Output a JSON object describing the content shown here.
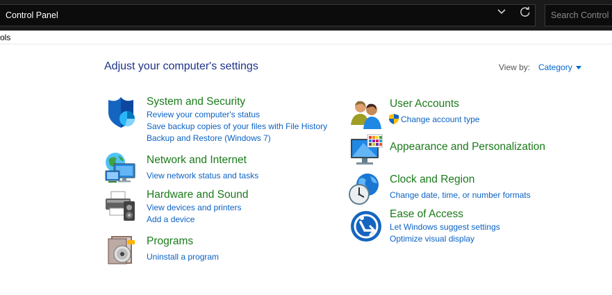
{
  "window": {
    "address_text": "Control Panel",
    "search_placeholder": "Search Control Panel",
    "menu_partial": "ols"
  },
  "main": {
    "heading": "Adjust your computer's settings",
    "view_by_label": "View by:",
    "view_by_value": "Category"
  },
  "categories_left": [
    {
      "icon": "shield-icon",
      "title": "System and Security",
      "links": [
        "Review your computer's status",
        "Save backup copies of your files with File History",
        "Backup and Restore (Windows 7)"
      ]
    },
    {
      "icon": "network-globe-icon",
      "title": "Network and Internet",
      "links": [
        "View network status and tasks"
      ]
    },
    {
      "icon": "printer-speaker-icon",
      "title": "Hardware and Sound",
      "links": [
        "View devices and printers",
        "Add a device"
      ]
    },
    {
      "icon": "programs-disc-icon",
      "title": "Programs",
      "links": [
        "Uninstall a program"
      ]
    }
  ],
  "categories_right": [
    {
      "icon": "users-icon",
      "title": "User Accounts",
      "links": [
        "Change account type"
      ]
    },
    {
      "icon": "monitor-palette-icon",
      "title": "Appearance and Personalization",
      "links": []
    },
    {
      "icon": "clock-globe-icon",
      "title": "Clock and Region",
      "links": [
        "Change date, time, or number formats"
      ]
    },
    {
      "icon": "ease-of-access-icon",
      "title": "Ease of Access",
      "links": [
        "Let Windows suggest settings",
        "Optimize visual display"
      ]
    }
  ],
  "colors": {
    "heading": "#1e3287",
    "category_title": "#1a7a1a",
    "link": "#0b62c4",
    "titlebar": "#1a1a1a"
  }
}
